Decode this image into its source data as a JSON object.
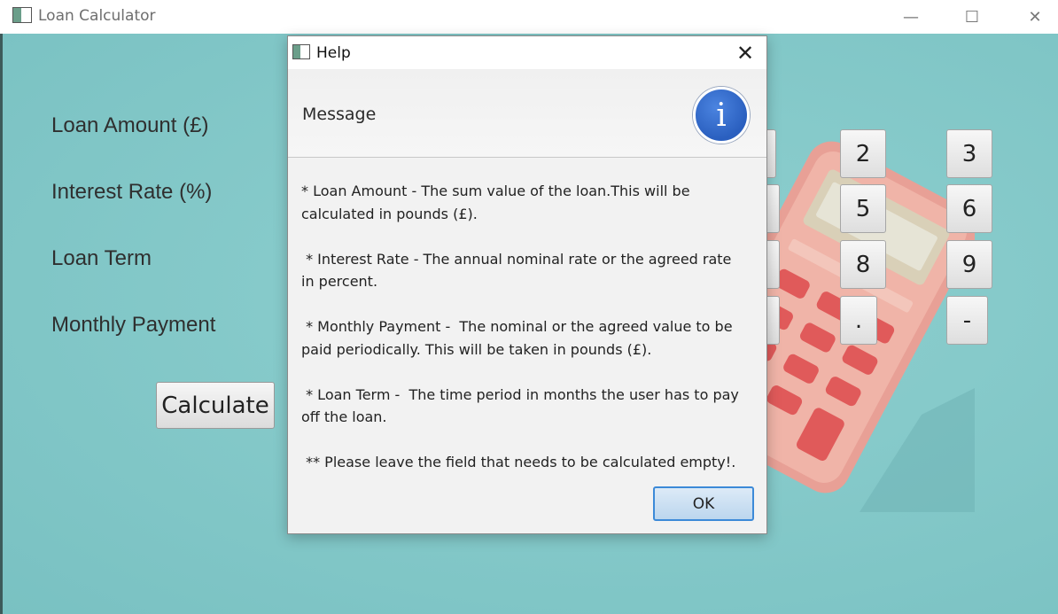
{
  "window": {
    "title": "Loan Calculator",
    "controls": {
      "minimize": "—",
      "maximize": "☐",
      "close": "✕"
    }
  },
  "form": {
    "labels": {
      "loan_amount": "Loan Amount (£)",
      "interest_rate": "Interest Rate (%)",
      "loan_term": "Loan Term",
      "monthly_payment": "Monthly Payment"
    },
    "calculate_label": "Calculate"
  },
  "keypad": {
    "keys": [
      "2",
      "3",
      "5",
      "6",
      "8",
      "9",
      ".",
      "-"
    ]
  },
  "dialog": {
    "title": "Help",
    "close_glyph": "✕",
    "header": "Message",
    "info_glyph": "i",
    "paragraphs": [
      "* Loan Amount - The sum value of the loan.This will be calculated in pounds (£).",
      " * Interest Rate - The annual nominal rate or the agreed rate in percent.",
      " * Monthly Payment -  The nominal or the agreed value to be paid periodically. This will be taken in pounds (£).",
      " * Loan Term -  The time period in months the user has to pay off the loan.",
      " ** Please leave the field that needs to be calculated empty!."
    ],
    "ok_label": "OK"
  },
  "colors": {
    "background": "#86caca",
    "dialog_bg": "#f2f2f2",
    "info_icon": "#2a5fbf",
    "ok_border": "#3c8ad8"
  }
}
